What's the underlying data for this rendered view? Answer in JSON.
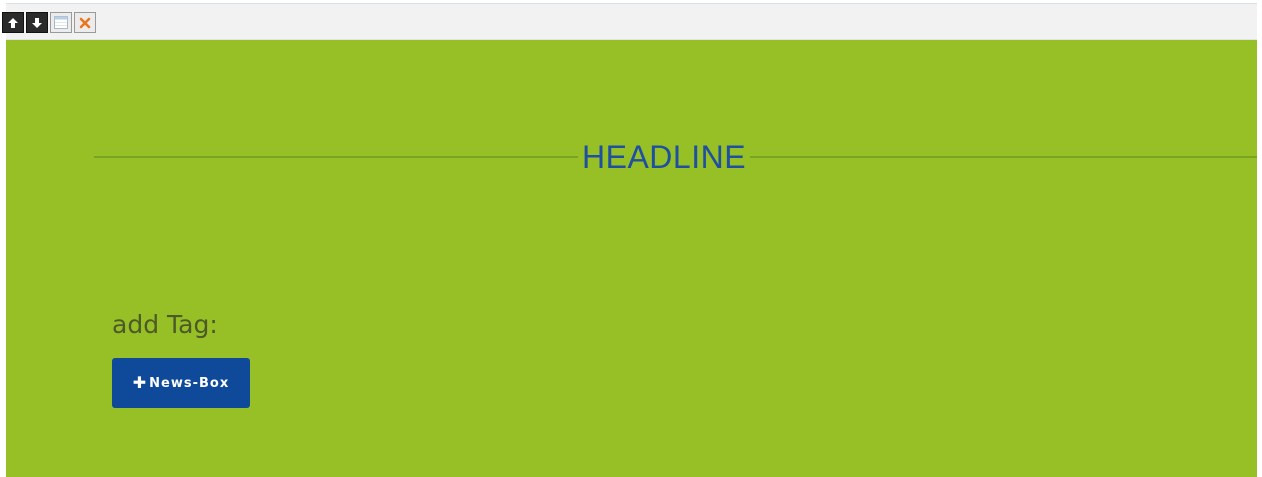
{
  "toolbar": {
    "buttons": [
      {
        "icon": "move-up-icon"
      },
      {
        "icon": "move-down-icon"
      },
      {
        "icon": "window-icon"
      },
      {
        "icon": "close-icon"
      }
    ]
  },
  "content": {
    "headline": "HEADLINE",
    "add_tag_label": "add Tag:",
    "news_box_button": {
      "icon": "plus-icon",
      "label": "News-Box"
    }
  },
  "colors": {
    "background": "#96c025",
    "headline": "#1f4fa0",
    "button": "#0f4a9a",
    "close_icon": "#e8761f"
  }
}
